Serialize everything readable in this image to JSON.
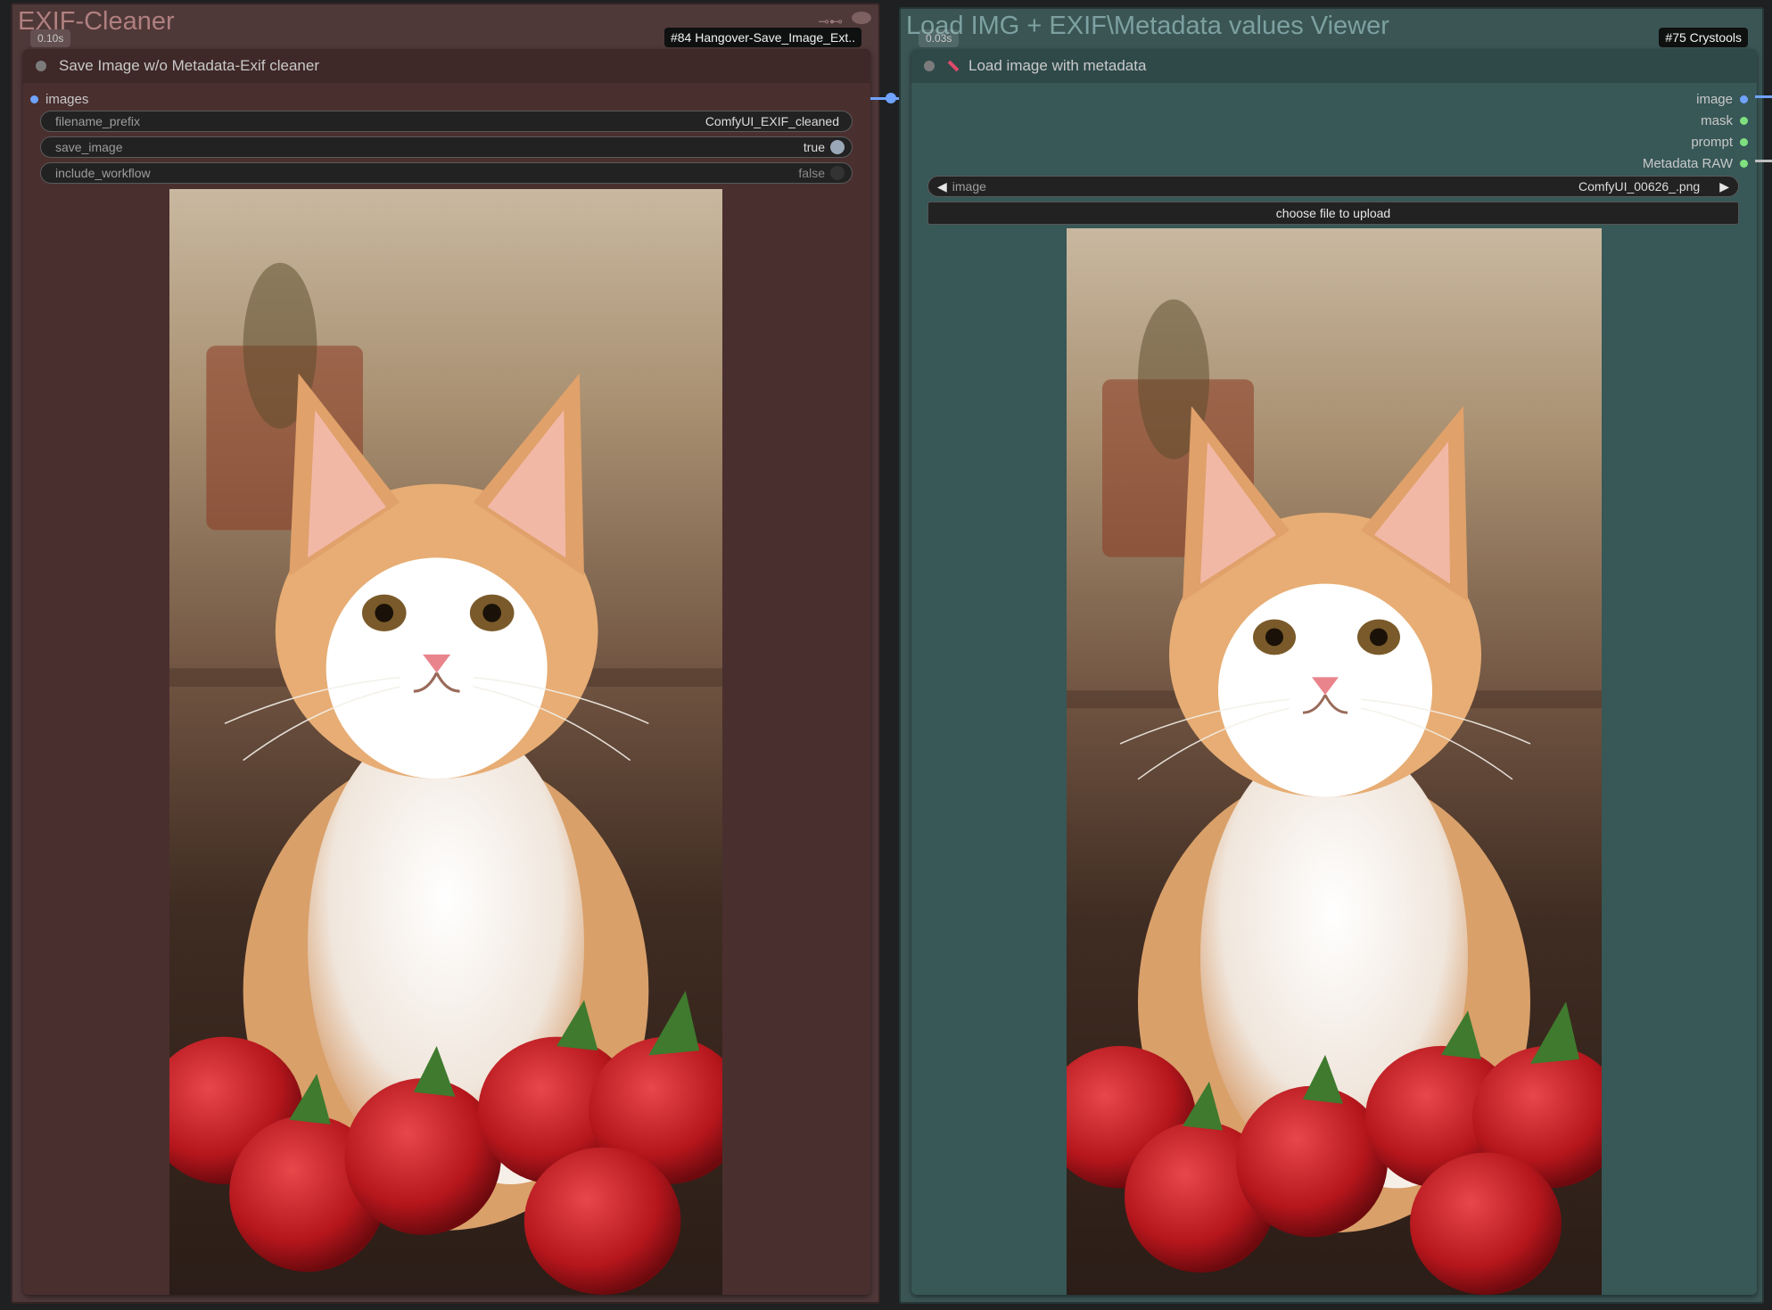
{
  "left_group": {
    "title": "EXIF-Cleaner",
    "node": {
      "time": "0.10s",
      "badge": "#84 Hangover-Save_Image_Ext..",
      "header_title": "Save Image w/o Metadata-Exif cleaner",
      "input_slot": "images",
      "widgets": {
        "filename_prefix": {
          "label": "filename_prefix",
          "value": "ComfyUI_EXIF_cleaned"
        },
        "save_image": {
          "label": "save_image",
          "value": "true"
        },
        "include_workflow": {
          "label": "include_workflow",
          "value": "false"
        }
      },
      "preview": {
        "icon": "kitten-with-strawberries-image"
      }
    }
  },
  "right_group": {
    "title": "Load IMG + EXIF\\Metadata values Viewer",
    "node": {
      "time": "0.03s",
      "badge": "#75 Crystools",
      "header_title": "Load image with metadata",
      "header_icon": "brush-icon",
      "outputs": [
        "image",
        "mask",
        "prompt",
        "Metadata RAW"
      ],
      "image_combo": {
        "label": "image",
        "value": "ComfyUI_00626_.png"
      },
      "upload_label": "choose file to upload",
      "preview": {
        "icon": "kitten-with-strawberries-image"
      }
    }
  },
  "colors": {
    "left_group": "#4f3838",
    "left_node": "#4a2f2f",
    "right_group": "#3b5555",
    "right_node": "#385757",
    "link": "#6fa3ff"
  }
}
